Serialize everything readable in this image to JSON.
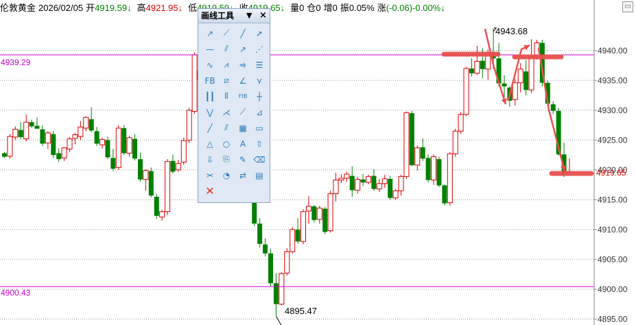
{
  "header": {
    "instrument": "伦敦黄金",
    "date": "2026/02/05",
    "open_label": "开",
    "open_value": "4919.59↓",
    "high_label": "高",
    "high_value": "4921.95↓",
    "low_label": "低",
    "low_value": "4919.59↓",
    "close_label": "收",
    "close_value": "4919.65↓",
    "volume": "量0",
    "position": "仓0",
    "increase": "增0",
    "amplitude": "振0.05%",
    "change_label": "涨",
    "change_value": "(-0.06)-0.00%↓"
  },
  "toolbox": {
    "title": "画线工具",
    "menu_icon": "▼",
    "close_icon": "×",
    "tools": [
      "arrow-line-icon",
      "ray-icon",
      "segment-icon",
      "trend-arrow-icon",
      "horizontal-line-icon",
      "parallel-line-icon",
      "up-arrow-icon",
      "zigzag-icon",
      "wave-icon",
      "polyline-icon",
      "channel-icon",
      "text-box-icon",
      "fib-icon",
      "fib-fan-icon",
      "trend-angle-icon",
      "fork-icon",
      "vertical-lines-icon",
      "cycle-lines-icon",
      "fib-time-icon",
      "gann-grid-icon",
      "fan-down-icon",
      "fan-lines-icon",
      "gann-fan-icon",
      "gann-box-icon",
      "slash-icon",
      "dual-slash-icon",
      "grid-icon",
      "rectangle-icon",
      "triangle-icon",
      "circle-icon",
      "text-icon",
      "up-arrow-mark-icon",
      "down-arrow-mark-icon",
      "copy-icon",
      "pen-icon",
      "eraser-icon",
      "tools-icon",
      "palette-icon",
      "swap-icon",
      "ruler-icon",
      "delete-icon"
    ],
    "fib_labels": {
      "fb": "FB",
      "fib": "FIB",
      "fibt": "FIB TIME"
    }
  },
  "axis": {
    "ticks": [
      "4940.00",
      "4935.00",
      "4930.00",
      "4925.00",
      "4920.00",
      "4915.00",
      "4910.00",
      "4905.00",
      "4900.00",
      "4895.00"
    ],
    "current_price": "4919.65"
  },
  "levels": {
    "upper": "4939.29",
    "lower": "4900.43"
  },
  "annotations": {
    "high_mark": "4943.68",
    "low_mark": "4895.47"
  },
  "colors": {
    "up": "#e00000",
    "down": "#008000",
    "level": "#cc00cc",
    "drawing": "#e85050",
    "grid": "#999999"
  },
  "chart_data": {
    "type": "candlestick",
    "title": "",
    "ylim": [
      4894.5,
      4948.0
    ],
    "candles": [
      [
        4922.8,
        4923.0,
        4922.0,
        4922.2
      ],
      [
        4922.3,
        4926.0,
        4921.9,
        4925.6
      ],
      [
        4925.5,
        4927.3,
        4925.0,
        4926.8
      ],
      [
        4926.7,
        4928.0,
        4925.2,
        4925.5
      ],
      [
        4925.2,
        4929.3,
        4924.8,
        4928.0
      ],
      [
        4928.0,
        4928.4,
        4927.0,
        4927.3
      ],
      [
        4927.4,
        4928.8,
        4927.0,
        4926.9
      ],
      [
        4926.8,
        4927.5,
        4924.0,
        4924.4
      ],
      [
        4924.5,
        4926.5,
        4923.5,
        4926.2
      ],
      [
        4926.0,
        4926.5,
        4922.0,
        4922.5
      ],
      [
        4922.8,
        4923.6,
        4921.3,
        4921.8
      ],
      [
        4922.0,
        4923.8,
        4921.5,
        4923.7
      ],
      [
        4923.5,
        4925.5,
        4923.0,
        4925.2
      ],
      [
        4925.3,
        4926.2,
        4924.3,
        4925.9
      ],
      [
        4925.6,
        4928.2,
        4925.0,
        4927.2
      ],
      [
        4927.0,
        4929.0,
        4926.5,
        4928.8
      ],
      [
        4928.5,
        4930.5,
        4926.3,
        4926.6
      ],
      [
        4926.5,
        4927.2,
        4924.0,
        4924.4
      ],
      [
        4924.2,
        4925.4,
        4923.6,
        4925.1
      ],
      [
        4925.0,
        4925.6,
        4921.8,
        4922.1
      ],
      [
        4922.0,
        4923.5,
        4919.8,
        4920.2
      ],
      [
        4920.4,
        4927.5,
        4920.0,
        4927.0
      ],
      [
        4927.0,
        4927.5,
        4922.5,
        4922.8
      ],
      [
        4922.8,
        4925.7,
        4922.2,
        4925.4
      ],
      [
        4925.2,
        4926.0,
        4921.6,
        4921.9
      ],
      [
        4921.8,
        4922.9,
        4918.0,
        4918.4
      ],
      [
        4918.4,
        4920.1,
        4916.5,
        4919.9
      ],
      [
        4919.8,
        4920.4,
        4915.4,
        4915.7
      ],
      [
        4915.5,
        4916.0,
        4911.8,
        4912.3
      ],
      [
        4912.1,
        4913.3,
        4911.5,
        4913.0
      ],
      [
        4913.0,
        4921.8,
        4912.4,
        4921.4
      ],
      [
        4921.5,
        4922.6,
        4919.4,
        4919.7
      ],
      [
        4920.0,
        4921.7,
        4919.7,
        4921.1
      ],
      [
        4921.3,
        4925.4,
        4920.8,
        4924.9
      ],
      [
        4925.0,
        4930.4,
        4924.5,
        4930.0
      ],
      [
        4929.8,
        4939.7,
        4929.4,
        4939.3
      ],
      [
        4935.1,
        4941.1,
        4934.0,
        4936.6
      ],
      [
        4936.7,
        4937.6,
        4933.0,
        4933.5
      ],
      [
        4933.5,
        4935.6,
        4932.5,
        4934.2
      ],
      [
        4934.3,
        4937.9,
        4933.9,
        4935.2
      ],
      [
        4935.4,
        4935.9,
        4931.4,
        4931.9
      ],
      [
        4932.0,
        4933.0,
        4928.5,
        4930.4
      ],
      [
        4930.5,
        4936.3,
        4930.0,
        4935.8
      ],
      [
        4935.8,
        4936.3,
        4930.5,
        4930.8
      ],
      [
        4930.8,
        4931.7,
        4926.5,
        4926.9
      ],
      [
        4926.8,
        4927.2,
        4917.0,
        4915.7
      ],
      [
        4915.7,
        4917.0,
        4910.6,
        4911.0
      ],
      [
        4911.0,
        4911.9,
        4907.0,
        4907.6
      ],
      [
        4907.5,
        4908.5,
        4905.5,
        4906.0
      ],
      [
        4906.0,
        4906.8,
        4900.5,
        4901.0
      ],
      [
        4901.0,
        4902.7,
        4895.5,
        4897.5
      ],
      [
        4897.5,
        4902.9,
        4897.3,
        4902.6
      ],
      [
        4902.7,
        4906.9,
        4902.3,
        4906.3
      ],
      [
        4906.3,
        4910.4,
        4906.0,
        4910.0
      ],
      [
        4910.0,
        4911.9,
        4907.6,
        4908.0
      ],
      [
        4908.0,
        4913.4,
        4907.5,
        4913.0
      ],
      [
        4913.1,
        4915.6,
        4911.0,
        4913.9
      ],
      [
        4913.9,
        4914.1,
        4911.2,
        4911.6
      ],
      [
        4911.7,
        4914.0,
        4911.0,
        4913.6
      ],
      [
        4913.5,
        4913.8,
        4909.2,
        4909.6
      ],
      [
        4909.8,
        4916.5,
        4909.5,
        4916.0
      ],
      [
        4916.0,
        4919.5,
        4914.7,
        4918.3
      ],
      [
        4918.3,
        4919.3,
        4917.8,
        4918.6
      ],
      [
        4918.6,
        4919.7,
        4918.0,
        4919.3
      ],
      [
        4919.0,
        4920.6,
        4915.5,
        4916.6
      ],
      [
        4916.6,
        4918.8,
        4916.0,
        4918.4
      ],
      [
        4918.4,
        4919.3,
        4917.3,
        4917.9
      ],
      [
        4917.9,
        4919.2,
        4917.6,
        4918.9
      ],
      [
        4919.0,
        4920.1,
        4916.5,
        4916.8
      ],
      [
        4916.8,
        4918.5,
        4916.3,
        4917.7
      ],
      [
        4917.7,
        4919.2,
        4917.0,
        4918.5
      ],
      [
        4918.5,
        4919.0,
        4915.0,
        4915.3
      ],
      [
        4915.3,
        4916.8,
        4915.0,
        4916.5
      ],
      [
        4916.5,
        4919.2,
        4915.7,
        4918.9
      ],
      [
        4918.9,
        4929.8,
        4918.5,
        4929.6
      ],
      [
        4929.5,
        4929.9,
        4920.6,
        4920.8
      ],
      [
        4920.8,
        4924.1,
        4919.9,
        4923.7
      ],
      [
        4923.8,
        4925.3,
        4921.5,
        4921.9
      ],
      [
        4922.0,
        4922.6,
        4917.9,
        4918.3
      ],
      [
        4918.3,
        4922.6,
        4917.5,
        4922.2
      ],
      [
        4921.8,
        4922.2,
        4917.1,
        4917.4
      ],
      [
        4917.4,
        4917.6,
        4914.0,
        4914.4
      ],
      [
        4914.5,
        4923.0,
        4914.0,
        4922.7
      ],
      [
        4922.7,
        4926.9,
        4922.2,
        4926.5
      ],
      [
        4926.5,
        4929.7,
        4926.0,
        4929.3
      ],
      [
        4929.3,
        4937.3,
        4929.0,
        4937.0
      ],
      [
        4937.0,
        4938.7,
        4935.7,
        4936.2
      ],
      [
        4936.2,
        4940.8,
        4935.9,
        4938.2
      ],
      [
        4938.3,
        4940.4,
        4935.4,
        4936.9
      ],
      [
        4936.9,
        4940.2,
        4935.1,
        4939.7
      ],
      [
        4939.7,
        4943.7,
        4937.0,
        4938.7
      ],
      [
        4938.7,
        4941.3,
        4934.0,
        4934.5
      ],
      [
        4934.5,
        4935.9,
        4932.0,
        4934.0
      ],
      [
        4933.8,
        4934.0,
        4930.6,
        4931.6
      ],
      [
        4931.8,
        4935.2,
        4930.8,
        4934.6
      ],
      [
        4934.6,
        4937.9,
        4933.0,
        4936.9
      ],
      [
        4936.5,
        4938.4,
        4932.5,
        4933.4
      ],
      [
        4933.4,
        4941.9,
        4932.9,
        4939.0
      ],
      [
        4939.0,
        4941.8,
        4938.5,
        4941.3
      ],
      [
        4941.3,
        4941.8,
        4934.0,
        4934.6
      ],
      [
        4934.6,
        4935.0,
        4930.7,
        4931.1
      ],
      [
        4931.0,
        4931.5,
        4929.4,
        4929.9
      ],
      [
        4929.9,
        4930.4,
        4922.4,
        4922.6
      ],
      [
        4922.6,
        4924.6,
        4918.8,
        4919.3
      ],
      [
        4919.6,
        4921.95,
        4919.59,
        4919.65
      ]
    ]
  }
}
